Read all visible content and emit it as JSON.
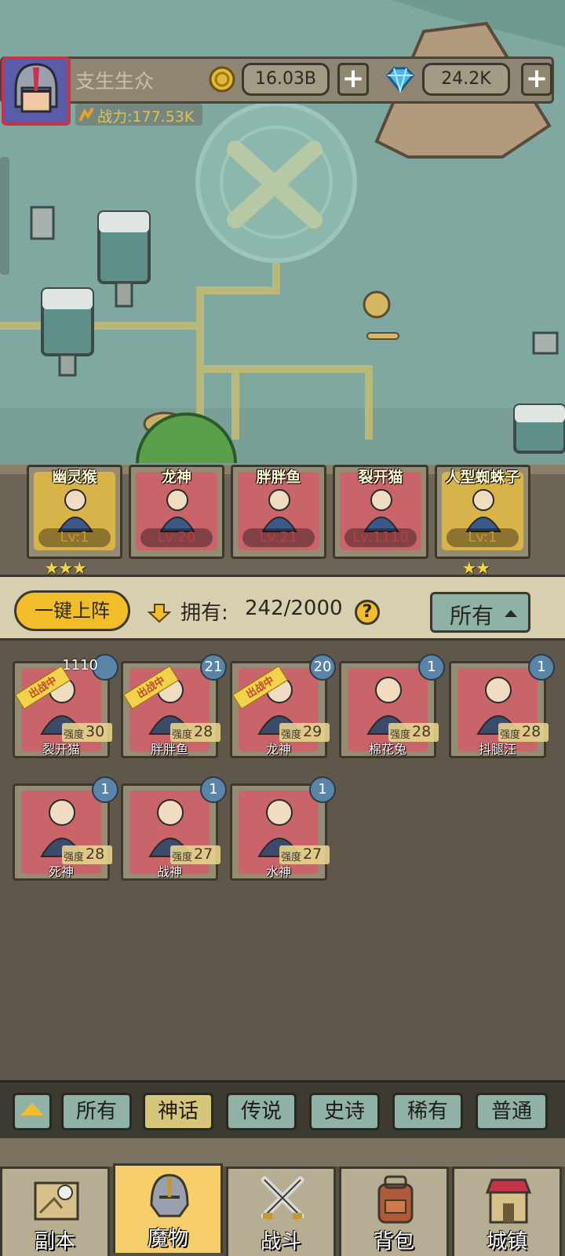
{
  "player": {
    "name": "支生生众",
    "power": "战力:177.53K",
    "gold": "16.03B",
    "diamonds": "24.2K",
    "plus": "+"
  },
  "team": [
    {
      "name": "幽灵猴",
      "level": "Lv:1",
      "color": "#d7b34a",
      "stars": "★★★"
    },
    {
      "name": "龙神",
      "level": "Lv:20",
      "color": "#c8646a",
      "stars": ""
    },
    {
      "name": "胖胖鱼",
      "level": "Lv:21",
      "color": "#c8646a",
      "stars": ""
    },
    {
      "name": "裂开猫",
      "level": "Lv:1110",
      "color": "#c8646a",
      "stars": ""
    },
    {
      "name": "人型蜘蛛子",
      "level": "Lv:1",
      "color": "#d7b34a",
      "stars": "★★"
    }
  ],
  "filter": {
    "deploy_button": "一键上阵",
    "own_label": "拥有:",
    "own_count": "242/2000",
    "help": "?",
    "sort_label": "所有"
  },
  "monsters": [
    {
      "name": "裂开猫",
      "badge": "1110",
      "strength_label": "强度",
      "strength": "30",
      "deployed": true
    },
    {
      "name": "胖胖鱼",
      "badge": "21",
      "strength_label": "强度",
      "strength": "28",
      "deployed": true
    },
    {
      "name": "龙神",
      "badge": "20",
      "strength_label": "强度",
      "strength": "29",
      "deployed": true
    },
    {
      "name": "棉花兔",
      "badge": "1",
      "strength_label": "强度",
      "strength": "28",
      "deployed": false
    },
    {
      "name": "抖腿汪",
      "badge": "1",
      "strength_label": "强度",
      "strength": "28",
      "deployed": false
    },
    {
      "name": "死神",
      "badge": "1",
      "strength_label": "强度",
      "strength": "28",
      "deployed": false
    },
    {
      "name": "战神",
      "badge": "1",
      "strength_label": "强度",
      "strength": "27",
      "deployed": false
    },
    {
      "name": "水神",
      "badge": "1",
      "strength_label": "强度",
      "strength": "27",
      "deployed": false
    }
  ],
  "deployed_ribbon": "出战中",
  "rarity_filters": [
    "所有",
    "神话",
    "传说",
    "史诗",
    "稀有",
    "普通"
  ],
  "rarity_active": "神话",
  "nav": [
    {
      "label": "副本",
      "icon": "map-icon"
    },
    {
      "label": "魔物",
      "icon": "helmet-icon",
      "active": true
    },
    {
      "label": "战斗",
      "icon": "swords-icon"
    },
    {
      "label": "背包",
      "icon": "backpack-icon"
    },
    {
      "label": "城镇",
      "icon": "shop-icon"
    }
  ],
  "colors": {
    "accent": "#f1bd2b",
    "card_red": "#c8646a",
    "filter_teal": "#8fb1a6",
    "badge_blue": "#5a85a8"
  }
}
